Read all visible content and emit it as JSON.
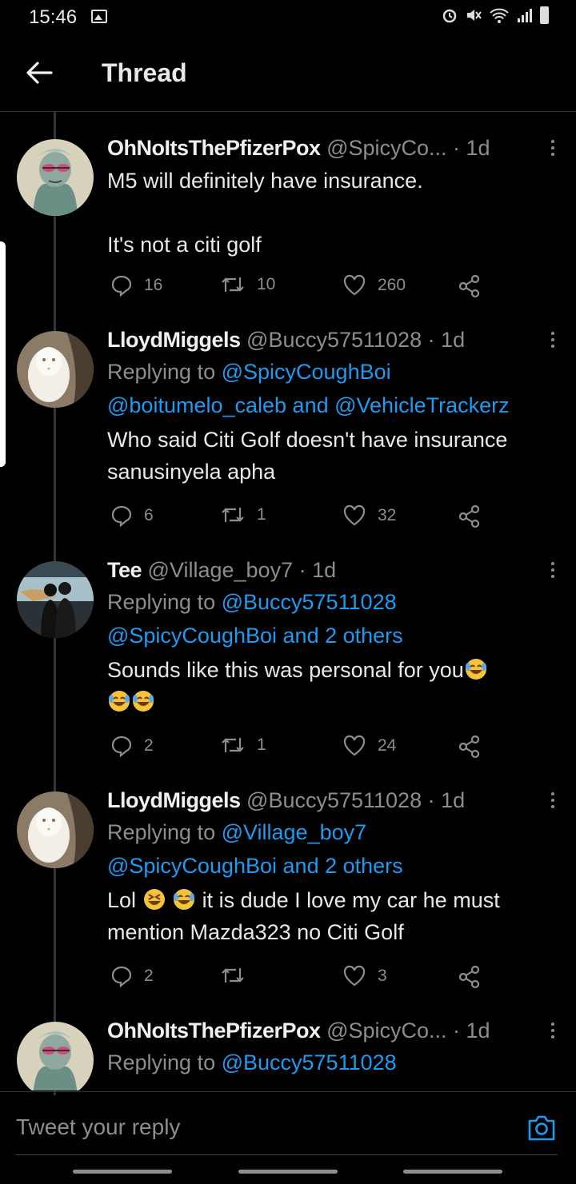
{
  "status": {
    "time": "15:46",
    "icons": [
      "alarm-icon",
      "mute-icon",
      "wifi-icon",
      "signal-icon",
      "battery-icon"
    ]
  },
  "header": {
    "title": "Thread",
    "back_icon": "arrow-left-icon"
  },
  "colors": {
    "link": "#1d9bf0",
    "bg": "#000000"
  },
  "tweets": [
    {
      "name": "OhNoItsThePfizerPox",
      "handle": "@SpicyCo...",
      "sep": " · ",
      "time": "1d",
      "body": [
        "M5 will definitely have insurance.",
        "",
        "It's not a citi golf"
      ],
      "replies": "16",
      "retweets": "10",
      "likes": "260"
    },
    {
      "name": "LloydMiggels",
      "handle": "@Buccy57511028",
      "sep": " · ",
      "time": "1d",
      "reply_prefix": "Replying to ",
      "reply_to_1": "@SpicyCoughBoi",
      "reply_to_2": "@boitumelo_caleb",
      "reply_and": " and ",
      "reply_to_3": "@VehicleTrackerz",
      "body": [
        "Who said Citi Golf doesn't have insurance",
        "sanusinyela apha"
      ],
      "replies": "6",
      "retweets": "1",
      "likes": "32"
    },
    {
      "name": "Tee",
      "handle": "@Village_boy7",
      "sep": " · ",
      "time": "1d",
      "reply_prefix": "Replying to ",
      "reply_to_1": "@Buccy57511028",
      "reply_to_2": "@SpicyCoughBoi",
      "reply_and": " and ",
      "reply_others": "2 others",
      "body": [
        "Sounds like this was personal for you"
      ],
      "replies": "2",
      "retweets": "1",
      "likes": "24"
    },
    {
      "name": "LloydMiggels",
      "handle": "@Buccy57511028",
      "sep": " · ",
      "time": "1d",
      "reply_prefix": "Replying to ",
      "reply_to_1": "@Village_boy7",
      "reply_to_2": "@SpicyCoughBoi",
      "reply_and": " and ",
      "reply_others": "2 others",
      "body_a": "Lol ",
      "body_b": " it is dude I love my car he must",
      "body_c": "mention Mazda323 no Citi Golf",
      "replies": "2",
      "retweets": "",
      "likes": "3"
    },
    {
      "name": "OhNoItsThePfizerPox",
      "handle": "@SpicyCo...",
      "sep": " · ",
      "time": "1d",
      "reply_prefix": "Replying to ",
      "reply_to_1": "@Buccy57511028"
    }
  ],
  "composer": {
    "placeholder": "Tweet your reply",
    "camera_icon": "camera-icon"
  }
}
